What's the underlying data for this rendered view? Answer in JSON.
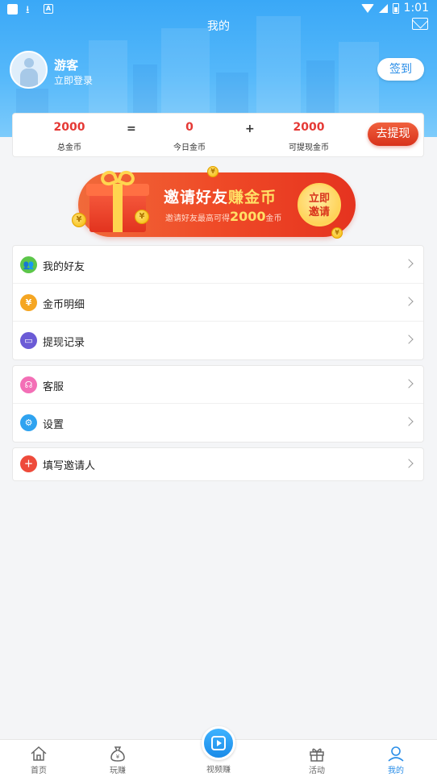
{
  "status_bar": {
    "time": "1:01"
  },
  "header": {
    "title": "我的"
  },
  "user": {
    "name": "游客",
    "login_prompt": "立即登录"
  },
  "checkin_label": "签到",
  "coins": {
    "total": {
      "value": "2000",
      "label": "总金币"
    },
    "op1": "=",
    "today": {
      "value": "0",
      "label": "今日金币"
    },
    "op2": "+",
    "withdrawable": {
      "value": "2000",
      "label": "可提现金币"
    },
    "withdraw_button": "去提现"
  },
  "banner": {
    "title_part1": "邀请好友",
    "title_part2": "赚金币",
    "subtitle_prefix": "邀请好友最高可得",
    "subtitle_amount": "2000",
    "subtitle_suffix": "金币",
    "invite_line1": "立即",
    "invite_line2": "邀请",
    "coin_symbol": "¥"
  },
  "menu_groups": [
    [
      {
        "label": "我的好友",
        "icon": "friends-icon",
        "color": "#5cc64a"
      },
      {
        "label": "金币明细",
        "icon": "yuan-icon",
        "color": "#f5a623"
      },
      {
        "label": "提现记录",
        "icon": "wallet-icon",
        "color": "#6b5bd6"
      }
    ],
    [
      {
        "label": "客服",
        "icon": "headset-icon",
        "color": "#f36fb6"
      },
      {
        "label": "设置",
        "icon": "gear-icon",
        "color": "#2fa3f0"
      }
    ],
    [
      {
        "label": "填写邀请人",
        "icon": "add-person-icon",
        "color": "#ee4b3b"
      }
    ]
  ],
  "tabs": [
    {
      "label": "首页",
      "icon": "home-icon"
    },
    {
      "label": "玩赚",
      "icon": "money-bag-icon"
    },
    {
      "label": "视频赚",
      "icon": "video-play-icon"
    },
    {
      "label": "活动",
      "icon": "gift-icon"
    },
    {
      "label": "我的",
      "icon": "person-icon"
    }
  ],
  "colors": {
    "accent": "#2a8ee8",
    "coin_red": "#e53935",
    "header_blue": "#3aa8f7"
  }
}
